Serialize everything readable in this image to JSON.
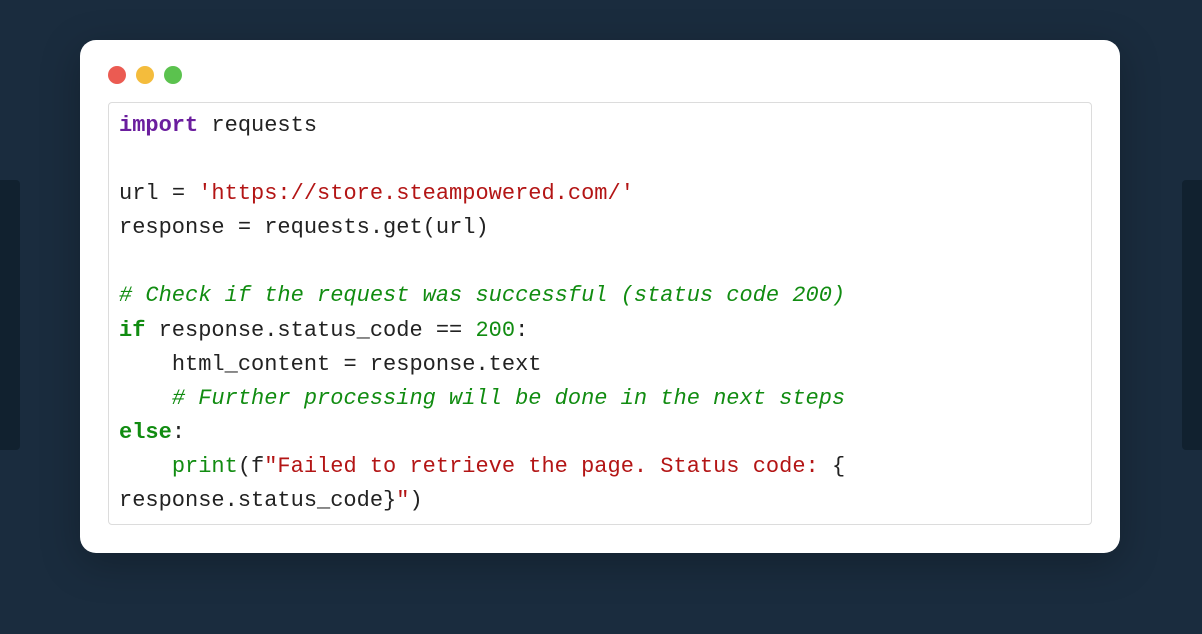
{
  "window": {
    "traffic_lights": {
      "red": "#eb5b52",
      "yellow": "#f4bc3c",
      "green": "#5bc24e"
    }
  },
  "code": {
    "kw_import": "import",
    "mod_requests": " requests",
    "var_url": "url ",
    "op_eq1": "=",
    "sp1": " ",
    "str_url": "'https://store.steampowered.com/'",
    "line_resp": "response ",
    "op_eq2": "=",
    "resp_call": " requests.get(url)",
    "cmt1": "# Check if the request was successful (status code 200)",
    "kw_if": "if",
    "if_cond": " response.status_code ",
    "op_eqeq": "==",
    "sp2": " ",
    "num_200": "200",
    "colon1": ":",
    "ind1": "    ",
    "assign_html": "html_content ",
    "op_eq3": "=",
    "resp_text": " response.text",
    "ind2": "    ",
    "cmt2": "# Further processing will be done in the next steps",
    "kw_else": "else",
    "colon2": ":",
    "ind3": "    ",
    "fn_print": "print",
    "paren_open": "(",
    "fprefix": "f",
    "str_fail_a": "\"Failed to retrieve the page. Status code: ",
    "brace_open": "{",
    "nl_wrap": "\n",
    "fexpr": "response.status_code",
    "brace_close": "}",
    "str_fail_b": "\"",
    "paren_close": ")"
  }
}
